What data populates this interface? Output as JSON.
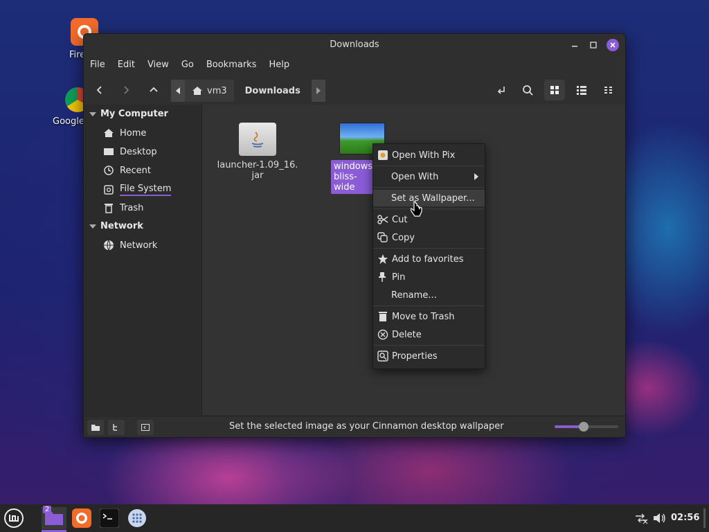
{
  "window": {
    "title": "Downloads"
  },
  "menubar": [
    "File",
    "Edit",
    "View",
    "Go",
    "Bookmarks",
    "Help"
  ],
  "breadcrumb": {
    "items": [
      "vm3",
      "Downloads"
    ]
  },
  "sidebar": {
    "sections": [
      {
        "title": "My Computer",
        "items": [
          "Home",
          "Desktop",
          "Recent",
          "File System",
          "Trash"
        ]
      },
      {
        "title": "Network",
        "items": [
          "Network"
        ]
      }
    ]
  },
  "files": [
    {
      "name_line1": "launcher-1.09_16.",
      "name_line2": "jar",
      "icon": "java-jar-icon"
    },
    {
      "name_line1": "windows_",
      "name_line2": "bliss-wide",
      "icon": "image-thumbnail",
      "selected": true
    }
  ],
  "context_menu": {
    "items": [
      {
        "label": "Open With Pix",
        "icon": "pix-app-icon"
      },
      {
        "label": "Open With",
        "icon": "",
        "submenu": true
      },
      {
        "label": "Set as Wallpaper...",
        "icon": "",
        "hovered": true
      },
      {
        "label": "Cut",
        "icon": "scissors-icon"
      },
      {
        "label": "Copy",
        "icon": "copy-icon"
      },
      {
        "label": "Add to favorites",
        "icon": "star-icon"
      },
      {
        "label": "Pin",
        "icon": "pin-icon"
      },
      {
        "label": "Rename...",
        "icon": ""
      },
      {
        "label": "Move to Trash",
        "icon": "trash-icon"
      },
      {
        "label": "Delete",
        "icon": "delete-icon"
      },
      {
        "label": "Properties",
        "icon": "properties-icon"
      }
    ]
  },
  "statusbar": {
    "message": "Set the selected image as your Cinnamon desktop wallpaper",
    "zoom_level": 0.4
  },
  "desktop_icons": [
    {
      "label": "Fire"
    },
    {
      "label": "Google"
    }
  ],
  "taskbar": {
    "workspace_count": "2",
    "clock": "02:56"
  },
  "colors": {
    "accent": "#8a5cd6",
    "window_bg": "#2f2f2f",
    "panel_bg": "#262626"
  }
}
